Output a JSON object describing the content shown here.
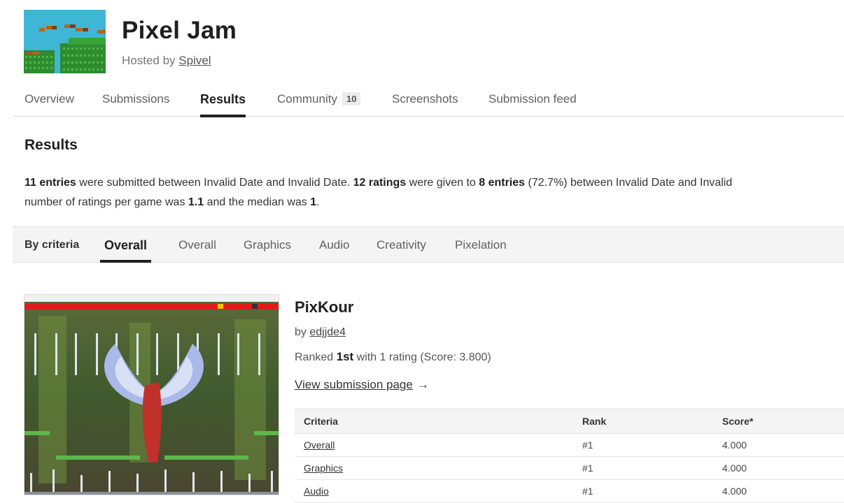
{
  "jam": {
    "title": "Pixel Jam",
    "hosted_prefix": "Hosted by",
    "host": "Spivel"
  },
  "tabs": [
    {
      "label": "Overview"
    },
    {
      "label": "Submissions"
    },
    {
      "label": "Results",
      "active": true
    },
    {
      "label": "Community",
      "badge": "10"
    },
    {
      "label": "Screenshots"
    },
    {
      "label": "Submission feed"
    }
  ],
  "results": {
    "title": "Results",
    "line1": {
      "entries": "11 entries",
      "t1": " were submitted between Invalid Date and Invalid Date. ",
      "ratings": "12 ratings",
      "t2": " were given to ",
      "rated_entries": "8 entries",
      "t3": " (72.7%) between Invalid Date and Invalid"
    },
    "line2": {
      "t1": "number of ratings per game was ",
      "mean": "1.1",
      "t2": " and the median was ",
      "median": "1",
      "t3": "."
    }
  },
  "criteria": {
    "label": "By criteria",
    "tabs": [
      "Overall",
      "Overall",
      "Graphics",
      "Audio",
      "Creativity",
      "Pixelation"
    ],
    "active_index": 0
  },
  "entry": {
    "title": "PixKour",
    "by_prefix": "by",
    "author": "edjjde4",
    "rank_prefix": "Ranked",
    "rank": "1st",
    "rank_suffix": "with 1 rating (Score: 3.800)",
    "view_link": "View submission page",
    "view_arrow": "→",
    "table": {
      "headers": [
        "Criteria",
        "Rank",
        "Score*"
      ],
      "rows": [
        [
          "Overall",
          "#1",
          "4.000"
        ],
        [
          "Graphics",
          "#1",
          "4.000"
        ],
        [
          "Audio",
          "#1",
          "4.000"
        ]
      ]
    }
  },
  "colors": {
    "accent": "#1f1f1f",
    "muted_text": "#606060",
    "bar_bg": "#f4f4f4"
  }
}
